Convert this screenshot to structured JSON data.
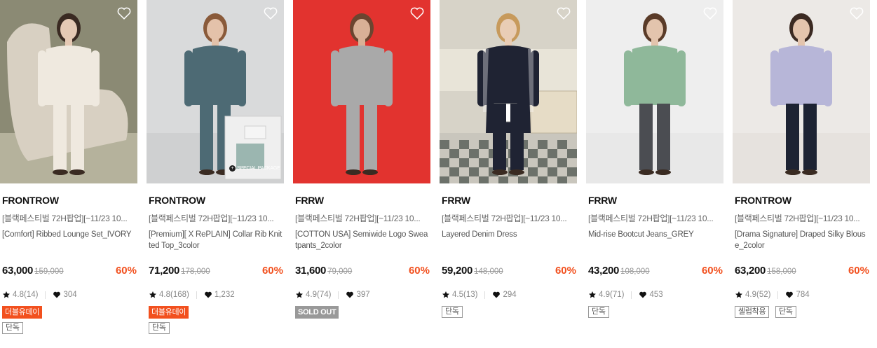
{
  "products": [
    {
      "brand": "FRONTROW",
      "promo": "[블랙페스티벌 72H팝업][~11/23 10...",
      "name": "[Comfort] Ribbed Lounge Set_IVORY",
      "price": "63,000",
      "original_price": "159,000",
      "discount": "60%",
      "rating": "4.8(14)",
      "likes": "304",
      "badge": "더블유데이",
      "badge_style": "orange",
      "tags": [
        "단독"
      ],
      "image_label": "",
      "colors": {
        "bg": "#8b8a74",
        "floor": "#b5b29c",
        "garment": "#efe9df",
        "skin": "#e5c9b4",
        "hair": "#3a2a22",
        "extra": "#d8d0c2"
      }
    },
    {
      "brand": "FRONTROW",
      "promo": "[블랙페스티벌 72H팝업][~11/23 10...",
      "name": "[Premium][ X RePLAIN] Collar Rib Knitted Top_3color",
      "price": "71,200",
      "original_price": "178,000",
      "discount": "60%",
      "rating": "4.8(168)",
      "likes": "1,232",
      "badge": "더블유데이",
      "badge_style": "orange",
      "tags": [
        "단독"
      ],
      "image_label": "SPECIAL PACKAGE",
      "colors": {
        "bg": "#d9dadb",
        "floor": "#cfd0d1",
        "garment": "#4d6a74",
        "skin": "#e4c2aa",
        "hair": "#8a5a3a",
        "extra": "#4d6a74"
      }
    },
    {
      "brand": "FRRW",
      "promo": "[블랙페스티벌 72H팝업][~11/23 10...",
      "name": "[COTTON USA] Semiwide Logo Sweatpants_2color",
      "price": "31,600",
      "original_price": "79,000",
      "discount": "60%",
      "rating": "4.9(74)",
      "likes": "397",
      "badge": "SOLD OUT",
      "badge_style": "grey",
      "tags": [],
      "image_label": "",
      "colors": {
        "bg": "#e2332f",
        "floor": "#e2332f",
        "garment": "#a9a9a9",
        "skin": "#d9b096",
        "hair": "#6b4530",
        "extra": "#e58bb4"
      }
    },
    {
      "brand": "FRRW",
      "promo": "[블랙페스티벌 72H팝업][~11/23 10...",
      "name": "Layered Denim Dress",
      "price": "59,200",
      "original_price": "148,000",
      "discount": "60%",
      "rating": "4.5(13)",
      "likes": "294",
      "badge": "",
      "badge_style": "",
      "tags": [
        "단독"
      ],
      "image_label": "",
      "colors": {
        "bg": "#d7d3c8",
        "floor": "#c9c6bd",
        "garment": "#1f2333",
        "skin": "#e9cdb5",
        "hair": "#c79a5c",
        "extra": "#ffffff"
      }
    },
    {
      "brand": "FRRW",
      "promo": "[블랙페스티벌 72H팝업][~11/23 10...",
      "name": "Mid-rise Bootcut Jeans_GREY",
      "price": "43,200",
      "original_price": "108,000",
      "discount": "60%",
      "rating": "4.9(71)",
      "likes": "453",
      "badge": "",
      "badge_style": "",
      "tags": [
        "단독"
      ],
      "image_label": "",
      "colors": {
        "bg": "#eeeeee",
        "floor": "#e8e8e8",
        "garment": "#8fb89a",
        "skin": "#e3c4ad",
        "hair": "#5a3b28",
        "extra": "#4b4d52"
      }
    },
    {
      "brand": "FRONTROW",
      "promo": "[블랙페스티벌 72H팝업][~11/23 10...",
      "name": "[Drama Signature] Draped Silky Blouse_2color",
      "price": "63,200",
      "original_price": "158,000",
      "discount": "60%",
      "rating": "4.9(52)",
      "likes": "784",
      "badge": "",
      "badge_style": "",
      "tags": [
        "셀럽착용",
        "단독"
      ],
      "image_label": "",
      "colors": {
        "bg": "#ece9e6",
        "floor": "#e6e2de",
        "garment": "#b7b6d8",
        "skin": "#e3c4ad",
        "hair": "#3b2a22",
        "extra": "#1d2333"
      }
    }
  ],
  "icons": {
    "heart": "heart-outline-icon",
    "star": "star-icon",
    "like": "heart-filled-icon"
  },
  "accent": "#f2501e"
}
